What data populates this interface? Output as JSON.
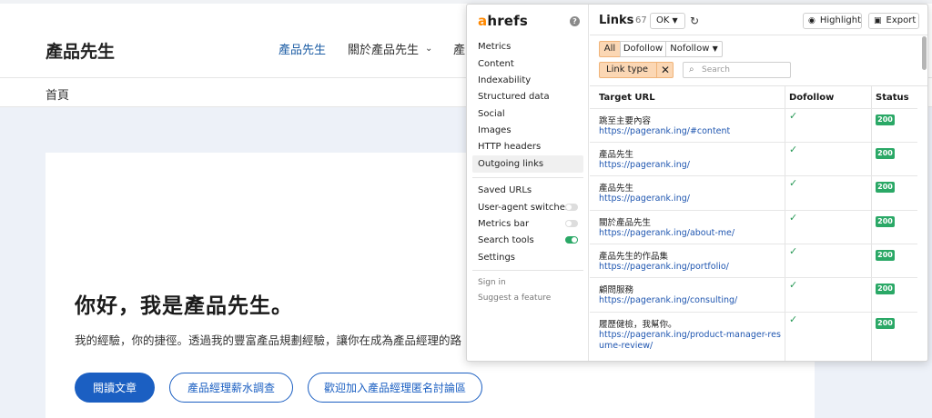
{
  "website": {
    "brand": "產品先生",
    "nav": [
      {
        "label": "產品先生"
      },
      {
        "label": "關於產品先生"
      },
      {
        "label": "產"
      }
    ],
    "breadcrumb": "首頁",
    "hero": {
      "title": "你好，我是產品先生。",
      "subtitle": "我的經驗，你的捷徑。透過我的豐富產品規劃經驗，讓你在成為產品經理的路",
      "buttons": [
        "閱讀文章",
        "產品經理薪水調查",
        "歡迎加入產品經理匿名討論區"
      ]
    }
  },
  "ahrefs": {
    "logo_a": "a",
    "logo_rest": "hrefs",
    "help": "?",
    "menu_main": [
      "Metrics",
      "Content",
      "Indexability",
      "Structured data",
      "Social",
      "Images",
      "HTTP headers",
      "Outgoing links"
    ],
    "menu_tools": [
      {
        "label": "Saved URLs",
        "toggle": null
      },
      {
        "label": "User-agent switcher",
        "toggle": "off"
      },
      {
        "label": "Metrics bar",
        "toggle": "off"
      },
      {
        "label": "Search tools",
        "toggle": "on"
      },
      {
        "label": "Settings",
        "toggle": null
      }
    ],
    "menu_footer": [
      "Sign in",
      "Suggest a feature"
    ],
    "links": {
      "title": "Links",
      "count": "67",
      "ok_label": "OK",
      "highlight_label": "Highlight",
      "export_label": "Export",
      "segments": [
        "All",
        "Dofollow",
        "Nofollow"
      ],
      "selected_segment": "All",
      "filter_chip": "Link type",
      "search_placeholder": "Search",
      "columns": [
        "Target URL",
        "Dofollow",
        "Status"
      ],
      "rows": [
        {
          "text": "跳至主要內容",
          "url": "https://pagerank.ing/#content",
          "dofollow": true,
          "status": "200"
        },
        {
          "text": "產品先生",
          "url": "https://pagerank.ing/",
          "dofollow": true,
          "status": "200"
        },
        {
          "text": "產品先生",
          "url": "https://pagerank.ing/",
          "dofollow": true,
          "status": "200"
        },
        {
          "text": "關於產品先生",
          "url": "https://pagerank.ing/about-me/",
          "dofollow": true,
          "status": "200"
        },
        {
          "text": "產品先生的作品集",
          "url": "https://pagerank.ing/portfolio/",
          "dofollow": true,
          "status": "200"
        },
        {
          "text": "顧問服務",
          "url": "https://pagerank.ing/consulting/",
          "dofollow": true,
          "status": "200"
        },
        {
          "text": "履歷健檢，我幫你。",
          "url": "https://pagerank.ing/product-manager-resume-review/",
          "dofollow": true,
          "status": "200"
        }
      ]
    }
  },
  "colors": {
    "accent": "#1b5fc2",
    "ahrefs_orange": "#ff8800",
    "status_green": "#2aa866",
    "segment_selected": "#fbd7b4"
  }
}
